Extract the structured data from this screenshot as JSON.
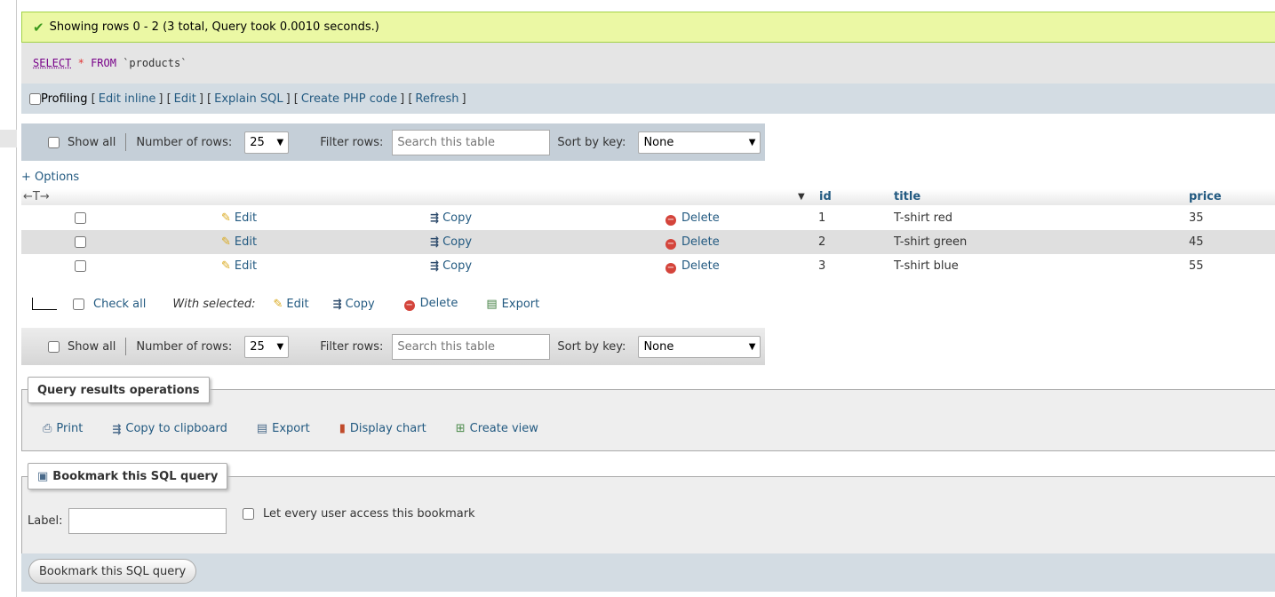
{
  "message": {
    "text": "Showing rows 0 - 2 (3 total, Query took 0.0010 seconds.)"
  },
  "sql": {
    "select": "SELECT",
    "star": "*",
    "from": "FROM",
    "table": "`products`"
  },
  "profiling": {
    "label": "Profiling",
    "links": [
      "Edit inline",
      "Edit",
      "Explain SQL",
      "Create PHP code",
      "Refresh"
    ]
  },
  "nav": {
    "show_all": "Show all",
    "num_rows_label": "Number of rows:",
    "num_rows_value": "25",
    "filter_label": "Filter rows:",
    "filter_placeholder": "Search this table",
    "sort_label": "Sort by key:",
    "sort_value": "None"
  },
  "options_link": "+ Options",
  "columns": [
    "id",
    "title",
    "price"
  ],
  "actions": {
    "edit": "Edit",
    "copy": "Copy",
    "delete": "Delete"
  },
  "rows": [
    {
      "id": "1",
      "title": "T-shirt red",
      "price": "35"
    },
    {
      "id": "2",
      "title": "T-shirt green",
      "price": "45"
    },
    {
      "id": "3",
      "title": "T-shirt blue",
      "price": "55"
    }
  ],
  "with_selected": {
    "check_all": "Check all",
    "label": "With selected:",
    "edit": "Edit",
    "copy": "Copy",
    "delete": "Delete",
    "export": "Export"
  },
  "query_ops": {
    "title": "Query results operations",
    "print": "Print",
    "copy_clipboard": "Copy to clipboard",
    "export": "Export",
    "display_chart": "Display chart",
    "create_view": "Create view"
  },
  "bookmark": {
    "title": "Bookmark this SQL query",
    "label": "Label:",
    "every_user": "Let every user access this bookmark",
    "button": "Bookmark this SQL query"
  }
}
